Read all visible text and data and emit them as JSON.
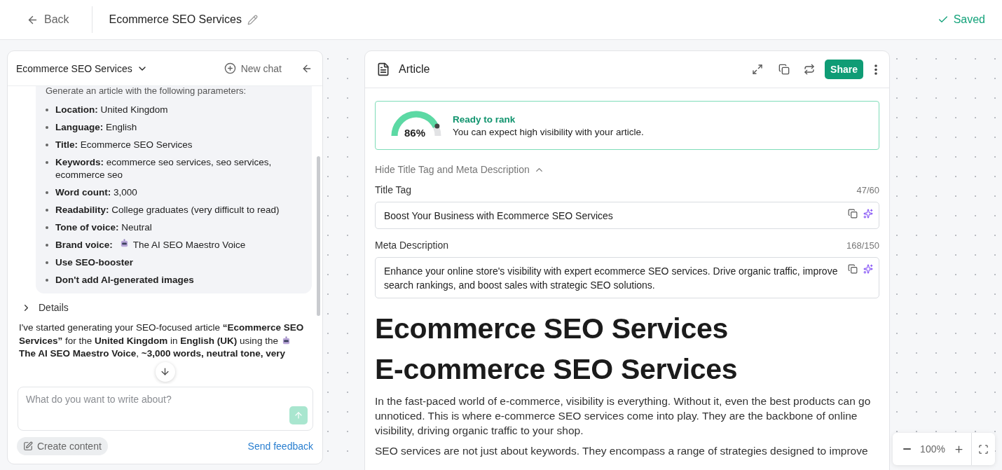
{
  "header": {
    "back": "Back",
    "title": "Ecommerce SEO Services",
    "status": "Saved"
  },
  "chat": {
    "title": "Ecommerce SEO Services",
    "new_chat": "New chat",
    "prompt_intro": "Generate an article with the following parameters:",
    "parameters": [
      {
        "kind": "param",
        "text": "**Location:** United Kingdom"
      },
      {
        "kind": "param",
        "text": "**Language:** English"
      },
      {
        "kind": "param",
        "text": "**Title:** Ecommerce SEO Services"
      },
      {
        "kind": "param",
        "text": "**Keywords:** ecommerce seo services, seo services, ecommerce seo"
      },
      {
        "kind": "param",
        "text": "**Word count:** 3,000"
      },
      {
        "kind": "param",
        "text": "**Readability:** College graduates (very difficult to read)"
      },
      {
        "kind": "param",
        "text": "**Tone of voice:** Neutral"
      },
      {
        "kind": "voice",
        "label": "Brand voice:",
        "value": "The AI SEO Maestro Voice"
      },
      {
        "kind": "flag",
        "text": "Use SEO-booster"
      },
      {
        "kind": "flag",
        "text": "Don't add AI-generated images"
      }
    ],
    "details": "Details",
    "reply_lines": [
      {
        "kind": "text",
        "text": "I've started generating your SEO-focused article **“Ecommerce SEO**"
      },
      {
        "kind": "voice",
        "text": "**Services”** for the **United Kingdom** in **English (UK)** using the"
      },
      {
        "kind": "text",
        "text": "**The AI SEO Maestro Voice**, **~3,000 words, neutral tone, very**"
      }
    ],
    "input": {
      "placeholder": "What do you want to write about?"
    },
    "create_content": "Create content",
    "feedback": "Send feedback"
  },
  "article": {
    "title": "Article",
    "share": "Share",
    "score": {
      "level": 0.86,
      "value": "86%",
      "heading": "Ready to rank",
      "text": "You can expect high visibility with your article."
    },
    "meta_toggle": {
      "label": "Hide Title Tag and Meta Description",
      "expanded": true
    },
    "fields": [
      {
        "label": "Title Tag",
        "count": "47/60",
        "value": "Boost Your Business with Ecommerce SEO Services"
      },
      {
        "label": "Meta Description",
        "count": "168/150",
        "value": "Enhance your online store's visibility with expert ecommerce SEO services. Drive organic traffic, improve search rankings, and boost sales with strategic SEO solutions."
      }
    ],
    "headings": [
      "Ecommerce SEO Services",
      "E-commerce SEO Services"
    ],
    "paragraphs": [
      "In the fast-paced world of e-commerce, visibility is everything. Without it, even the best products can go unnoticed. This is where e-commerce SEO services come into play. They are the backbone of online visibility, driving organic traffic to your shop.",
      "SEO services are not just about keywords. They encompass a range of strategies designed to improve"
    ]
  },
  "zoom": {
    "value": "100%"
  }
}
